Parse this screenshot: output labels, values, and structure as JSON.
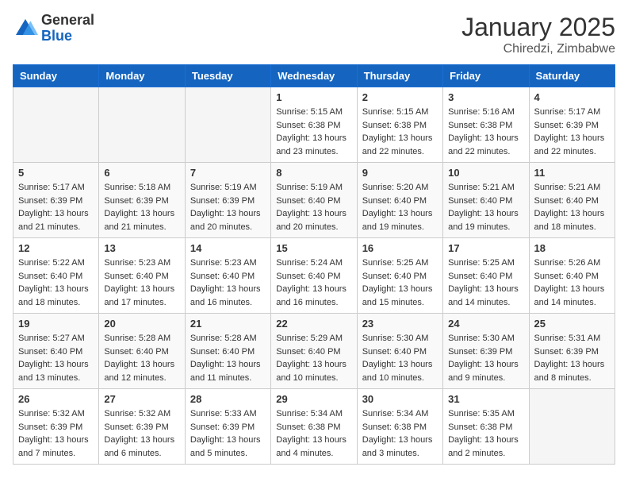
{
  "logo": {
    "general": "General",
    "blue": "Blue"
  },
  "header": {
    "month": "January 2025",
    "location": "Chiredzi, Zimbabwe"
  },
  "days_of_week": [
    "Sunday",
    "Monday",
    "Tuesday",
    "Wednesday",
    "Thursday",
    "Friday",
    "Saturday"
  ],
  "weeks": [
    [
      {
        "day": "",
        "info": ""
      },
      {
        "day": "",
        "info": ""
      },
      {
        "day": "",
        "info": ""
      },
      {
        "day": "1",
        "info": "Sunrise: 5:15 AM\nSunset: 6:38 PM\nDaylight: 13 hours\nand 23 minutes."
      },
      {
        "day": "2",
        "info": "Sunrise: 5:15 AM\nSunset: 6:38 PM\nDaylight: 13 hours\nand 22 minutes."
      },
      {
        "day": "3",
        "info": "Sunrise: 5:16 AM\nSunset: 6:38 PM\nDaylight: 13 hours\nand 22 minutes."
      },
      {
        "day": "4",
        "info": "Sunrise: 5:17 AM\nSunset: 6:39 PM\nDaylight: 13 hours\nand 22 minutes."
      }
    ],
    [
      {
        "day": "5",
        "info": "Sunrise: 5:17 AM\nSunset: 6:39 PM\nDaylight: 13 hours\nand 21 minutes."
      },
      {
        "day": "6",
        "info": "Sunrise: 5:18 AM\nSunset: 6:39 PM\nDaylight: 13 hours\nand 21 minutes."
      },
      {
        "day": "7",
        "info": "Sunrise: 5:19 AM\nSunset: 6:39 PM\nDaylight: 13 hours\nand 20 minutes."
      },
      {
        "day": "8",
        "info": "Sunrise: 5:19 AM\nSunset: 6:40 PM\nDaylight: 13 hours\nand 20 minutes."
      },
      {
        "day": "9",
        "info": "Sunrise: 5:20 AM\nSunset: 6:40 PM\nDaylight: 13 hours\nand 19 minutes."
      },
      {
        "day": "10",
        "info": "Sunrise: 5:21 AM\nSunset: 6:40 PM\nDaylight: 13 hours\nand 19 minutes."
      },
      {
        "day": "11",
        "info": "Sunrise: 5:21 AM\nSunset: 6:40 PM\nDaylight: 13 hours\nand 18 minutes."
      }
    ],
    [
      {
        "day": "12",
        "info": "Sunrise: 5:22 AM\nSunset: 6:40 PM\nDaylight: 13 hours\nand 18 minutes."
      },
      {
        "day": "13",
        "info": "Sunrise: 5:23 AM\nSunset: 6:40 PM\nDaylight: 13 hours\nand 17 minutes."
      },
      {
        "day": "14",
        "info": "Sunrise: 5:23 AM\nSunset: 6:40 PM\nDaylight: 13 hours\nand 16 minutes."
      },
      {
        "day": "15",
        "info": "Sunrise: 5:24 AM\nSunset: 6:40 PM\nDaylight: 13 hours\nand 16 minutes."
      },
      {
        "day": "16",
        "info": "Sunrise: 5:25 AM\nSunset: 6:40 PM\nDaylight: 13 hours\nand 15 minutes."
      },
      {
        "day": "17",
        "info": "Sunrise: 5:25 AM\nSunset: 6:40 PM\nDaylight: 13 hours\nand 14 minutes."
      },
      {
        "day": "18",
        "info": "Sunrise: 5:26 AM\nSunset: 6:40 PM\nDaylight: 13 hours\nand 14 minutes."
      }
    ],
    [
      {
        "day": "19",
        "info": "Sunrise: 5:27 AM\nSunset: 6:40 PM\nDaylight: 13 hours\nand 13 minutes."
      },
      {
        "day": "20",
        "info": "Sunrise: 5:28 AM\nSunset: 6:40 PM\nDaylight: 13 hours\nand 12 minutes."
      },
      {
        "day": "21",
        "info": "Sunrise: 5:28 AM\nSunset: 6:40 PM\nDaylight: 13 hours\nand 11 minutes."
      },
      {
        "day": "22",
        "info": "Sunrise: 5:29 AM\nSunset: 6:40 PM\nDaylight: 13 hours\nand 10 minutes."
      },
      {
        "day": "23",
        "info": "Sunrise: 5:30 AM\nSunset: 6:40 PM\nDaylight: 13 hours\nand 10 minutes."
      },
      {
        "day": "24",
        "info": "Sunrise: 5:30 AM\nSunset: 6:39 PM\nDaylight: 13 hours\nand 9 minutes."
      },
      {
        "day": "25",
        "info": "Sunrise: 5:31 AM\nSunset: 6:39 PM\nDaylight: 13 hours\nand 8 minutes."
      }
    ],
    [
      {
        "day": "26",
        "info": "Sunrise: 5:32 AM\nSunset: 6:39 PM\nDaylight: 13 hours\nand 7 minutes."
      },
      {
        "day": "27",
        "info": "Sunrise: 5:32 AM\nSunset: 6:39 PM\nDaylight: 13 hours\nand 6 minutes."
      },
      {
        "day": "28",
        "info": "Sunrise: 5:33 AM\nSunset: 6:39 PM\nDaylight: 13 hours\nand 5 minutes."
      },
      {
        "day": "29",
        "info": "Sunrise: 5:34 AM\nSunset: 6:38 PM\nDaylight: 13 hours\nand 4 minutes."
      },
      {
        "day": "30",
        "info": "Sunrise: 5:34 AM\nSunset: 6:38 PM\nDaylight: 13 hours\nand 3 minutes."
      },
      {
        "day": "31",
        "info": "Sunrise: 5:35 AM\nSunset: 6:38 PM\nDaylight: 13 hours\nand 2 minutes."
      },
      {
        "day": "",
        "info": ""
      }
    ]
  ]
}
